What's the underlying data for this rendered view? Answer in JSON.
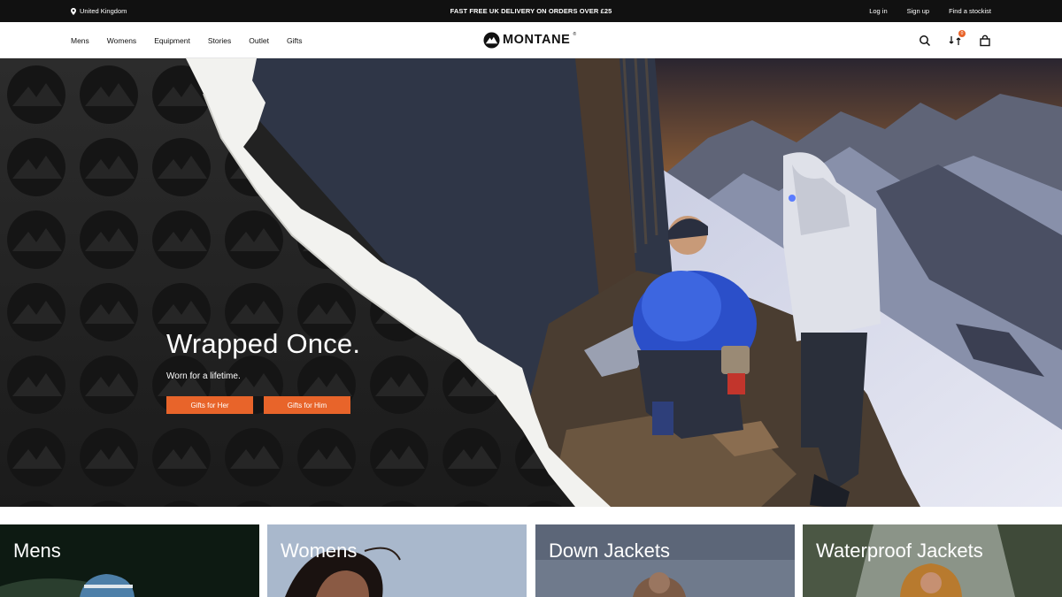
{
  "topbar": {
    "location": "United Kingdom",
    "promo": "FAST FREE UK DELIVERY ON ORDERS OVER £25",
    "links": [
      "Log in",
      "Sign up",
      "Find a stockist"
    ]
  },
  "nav": {
    "menu": [
      "Mens",
      "Womens",
      "Equipment",
      "Stories",
      "Outlet",
      "Gifts"
    ],
    "logo": "MONTANE",
    "compare_count": "0"
  },
  "hero": {
    "headline": "Wrapped Once.",
    "subheadline": "Worn for a lifetime.",
    "buttons": [
      "Gifts for Her",
      "Gifts for Him"
    ]
  },
  "tiles": [
    "Mens",
    "Womens",
    "Down Jackets",
    "Waterproof Jackets"
  ],
  "colors": {
    "accent": "#e8642a",
    "topbar_bg": "#111111",
    "hero_left_bg": "#222222"
  }
}
